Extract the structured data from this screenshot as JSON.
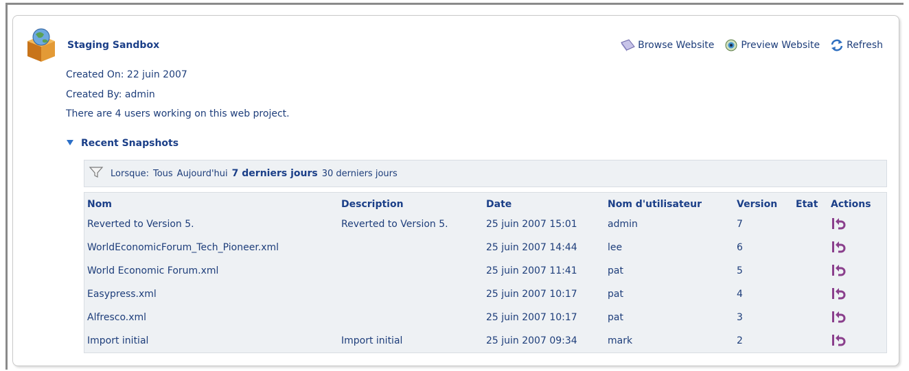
{
  "header": {
    "title": "Staging Sandbox",
    "created_on": "Created On: 22 juin 2007",
    "created_by": "Created By: admin",
    "users_text": "There are 4 users working on this web project."
  },
  "actions": {
    "browse": "Browse Website",
    "preview": "Preview Website",
    "refresh": "Refresh"
  },
  "snapshots": {
    "title": "Recent Snapshots",
    "filter_label": "Lorsque:",
    "filter_options": [
      "Tous",
      "Aujourd'hui",
      "7 derniers jours",
      "30 derniers jours"
    ],
    "filter_selected": "7 derniers jours",
    "columns": [
      "Nom",
      "Description",
      "Date",
      "Nom d'utilisateur",
      "Version",
      "Etat",
      "Actions"
    ],
    "rows": [
      {
        "name": "Reverted to Version 5.",
        "description": "Reverted to Version 5.",
        "date": "25 juin 2007 15:01",
        "user": "admin",
        "version": "7"
      },
      {
        "name": "WorldEconomicForum_Tech_Pioneer.xml",
        "description": "",
        "date": "25 juin 2007 14:44",
        "user": "lee",
        "version": "6"
      },
      {
        "name": "World Economic Forum.xml",
        "description": "",
        "date": "25 juin 2007 11:41",
        "user": "pat",
        "version": "5"
      },
      {
        "name": "Easypress.xml",
        "description": "",
        "date": "25 juin 2007 10:17",
        "user": "pat",
        "version": "4"
      },
      {
        "name": "Alfresco.xml",
        "description": "",
        "date": "25 juin 2007 10:17",
        "user": "pat",
        "version": "3"
      },
      {
        "name": "Import initial",
        "description": "Import initial",
        "date": "25 juin 2007 09:34",
        "user": "mark",
        "version": "2"
      }
    ]
  },
  "icons": {
    "sandbox": "sandbox-box-globe-icon",
    "browse": "book-icon",
    "preview": "eye-icon",
    "refresh": "refresh-arrows-icon",
    "collapse": "triangle-down-icon",
    "filter": "funnel-icon",
    "revert": "revert-arrow-icon"
  },
  "colors": {
    "link": "#1d3d7a",
    "heading": "#1b3f88",
    "panel_bg": "#eef1f4",
    "revert_icon": "#8a3f8c"
  }
}
